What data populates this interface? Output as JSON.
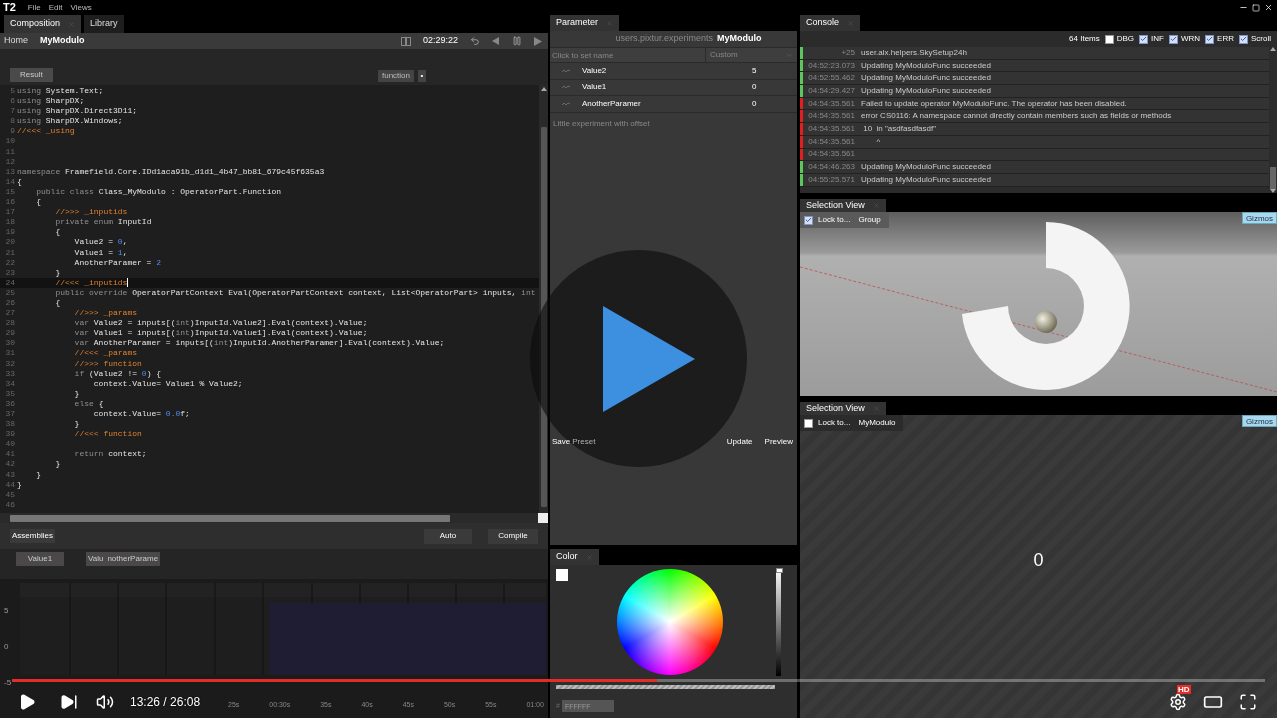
{
  "menu": {
    "logo": "T2",
    "items": [
      "File",
      "Edit",
      "Views"
    ]
  },
  "composition": {
    "tabs": [
      {
        "label": "Composition",
        "selected": true
      },
      {
        "label": "Library",
        "selected": false
      }
    ],
    "breadcrumbs": [
      "Home",
      "MyModulo"
    ],
    "time": "02:29:22",
    "result_button": "Result",
    "function_tag": "function",
    "tag_button": "•",
    "code_lines": [
      {
        "n": "5",
        "highlighted": false,
        "t": [
          {
            "kind": "keyword",
            "text": "using "
          },
          {
            "kind": "code",
            "text": "System.Text;"
          }
        ]
      },
      {
        "n": "6",
        "highlighted": false,
        "t": [
          {
            "kind": "keyword",
            "text": "using "
          },
          {
            "kind": "code",
            "text": "SharpDX;"
          }
        ]
      },
      {
        "n": "7",
        "highlighted": false,
        "t": [
          {
            "kind": "keyword",
            "text": "using "
          },
          {
            "kind": "code",
            "text": "SharpDX.Direct3D11;"
          }
        ]
      },
      {
        "n": "8",
        "highlighted": false,
        "t": [
          {
            "kind": "keyword",
            "text": "using "
          },
          {
            "kind": "code",
            "text": "SharpDX.Windows;"
          }
        ]
      },
      {
        "n": "9",
        "highlighted": false,
        "t": [
          {
            "kind": "comment",
            "text": "//<<< _using"
          }
        ]
      },
      {
        "n": "10",
        "highlighted": false
      },
      {
        "n": "11",
        "highlighted": false
      },
      {
        "n": "12",
        "highlighted": false
      },
      {
        "n": "13",
        "highlighted": false,
        "t": [
          {
            "kind": "keyword",
            "text": "namespace "
          },
          {
            "kind": "code",
            "text": "Framefield.Core.IDd1aca91b_d1d1_4b47_bb81_679c45f635a3"
          }
        ]
      },
      {
        "n": "14",
        "highlighted": false,
        "t": [
          {
            "kind": "code",
            "text": "{"
          }
        ]
      },
      {
        "n": "15",
        "highlighted": false,
        "t": [
          {
            "kind": "keyword",
            "text": "    public class "
          },
          {
            "kind": "code",
            "text": "Class_MyModulo : OperatorPart.Function"
          }
        ]
      },
      {
        "n": "16",
        "highlighted": false,
        "t": [
          {
            "kind": "code",
            "text": "    {"
          }
        ]
      },
      {
        "n": "17",
        "highlighted": false,
        "t": [
          {
            "kind": "comment",
            "text": "        //>>> _inputids"
          }
        ]
      },
      {
        "n": "18",
        "highlighted": false,
        "t": [
          {
            "kind": "keyword",
            "text": "        private enum "
          },
          {
            "kind": "code",
            "text": "InputId"
          }
        ]
      },
      {
        "n": "19",
        "highlighted": false,
        "t": [
          {
            "kind": "code",
            "text": "        {"
          }
        ]
      },
      {
        "n": "20",
        "highlighted": false,
        "t": [
          {
            "kind": "code",
            "text": "            Value2 = "
          },
          {
            "kind": "number",
            "text": "0"
          },
          {
            "kind": "code",
            "text": ","
          }
        ]
      },
      {
        "n": "21",
        "highlighted": false,
        "t": [
          {
            "kind": "code",
            "text": "            Value1 = "
          },
          {
            "kind": "number",
            "text": "1"
          },
          {
            "kind": "code",
            "text": ","
          }
        ]
      },
      {
        "n": "22",
        "highlighted": false,
        "t": [
          {
            "kind": "code",
            "text": "            AnotherParamer = "
          },
          {
            "kind": "number",
            "text": "2"
          }
        ]
      },
      {
        "n": "23",
        "highlighted": false,
        "t": [
          {
            "kind": "code",
            "text": "        }"
          }
        ]
      },
      {
        "n": "24",
        "highlighted": true,
        "t": [
          {
            "kind": "comment",
            "text": "        //<<< _inputids"
          }
        ]
      },
      {
        "n": "25",
        "highlighted": false,
        "t": [
          {
            "kind": "keyword",
            "text": "        public override "
          },
          {
            "kind": "code",
            "text": "OperatorPartContext Eval(OperatorPartContext context, List<OperatorPart> inputs, "
          },
          {
            "kind": "keyword",
            "text": "int"
          }
        ]
      },
      {
        "n": "26",
        "highlighted": false,
        "t": [
          {
            "kind": "code",
            "text": "        {"
          }
        ]
      },
      {
        "n": "27",
        "highlighted": false,
        "t": [
          {
            "kind": "comment",
            "text": "            //>>> _params"
          }
        ]
      },
      {
        "n": "28",
        "highlighted": false,
        "t": [
          {
            "kind": "keyword",
            "text": "            var "
          },
          {
            "kind": "code",
            "text": "Value2 = inputs[("
          },
          {
            "kind": "keyword",
            "text": "int"
          },
          {
            "kind": "code",
            "text": ")InputId.Value2].Eval(context).Value;"
          }
        ]
      },
      {
        "n": "29",
        "highlighted": false,
        "t": [
          {
            "kind": "keyword",
            "text": "            var "
          },
          {
            "kind": "code",
            "text": "Value1 = inputs[("
          },
          {
            "kind": "keyword",
            "text": "int"
          },
          {
            "kind": "code",
            "text": ")InputId.Value1].Eval(context).Value;"
          }
        ]
      },
      {
        "n": "30",
        "highlighted": false,
        "t": [
          {
            "kind": "keyword",
            "text": "            var "
          },
          {
            "kind": "code",
            "text": "AnotherParamer = inputs[("
          },
          {
            "kind": "keyword",
            "text": "int"
          },
          {
            "kind": "code",
            "text": ")InputId.AnotherParamer].Eval(context).Value;"
          }
        ]
      },
      {
        "n": "31",
        "highlighted": false,
        "t": [
          {
            "kind": "comment",
            "text": "            //<<< _params"
          }
        ]
      },
      {
        "n": "32",
        "highlighted": false,
        "t": [
          {
            "kind": "comment",
            "text": "            //>>> function"
          }
        ]
      },
      {
        "n": "33",
        "highlighted": false,
        "t": [
          {
            "kind": "keyword",
            "text": "            if "
          },
          {
            "kind": "code",
            "text": "(Value2 != "
          },
          {
            "kind": "number",
            "text": "0"
          },
          {
            "kind": "code",
            "text": ") {"
          }
        ]
      },
      {
        "n": "34",
        "highlighted": false,
        "t": [
          {
            "kind": "code",
            "text": "                context.Value= Value1 % Value2;"
          }
        ]
      },
      {
        "n": "35",
        "highlighted": false,
        "t": [
          {
            "kind": "code",
            "text": "            }"
          }
        ]
      },
      {
        "n": "36",
        "highlighted": false,
        "t": [
          {
            "kind": "keyword",
            "text": "            else "
          },
          {
            "kind": "code",
            "text": "{"
          }
        ]
      },
      {
        "n": "37",
        "highlighted": false,
        "t": [
          {
            "kind": "code",
            "text": "                context.Value= "
          },
          {
            "kind": "number",
            "text": "0.0"
          },
          {
            "kind": "code",
            "text": "f;"
          }
        ]
      },
      {
        "n": "38",
        "highlighted": false,
        "t": [
          {
            "kind": "code",
            "text": "            }"
          }
        ]
      },
      {
        "n": "39",
        "highlighted": false,
        "t": [
          {
            "kind": "comment",
            "text": "            //<<< function"
          }
        ]
      },
      {
        "n": "40",
        "highlighted": false
      },
      {
        "n": "41",
        "highlighted": false,
        "t": [
          {
            "kind": "keyword",
            "text": "            return "
          },
          {
            "kind": "code",
            "text": "context;"
          }
        ]
      },
      {
        "n": "42",
        "highlighted": false,
        "t": [
          {
            "kind": "code",
            "text": "        }"
          }
        ]
      },
      {
        "n": "43",
        "highlighted": false,
        "t": [
          {
            "kind": "code",
            "text": "    }"
          }
        ]
      },
      {
        "n": "44",
        "highlighted": false,
        "t": [
          {
            "kind": "code",
            "text": "}"
          }
        ]
      },
      {
        "n": "45",
        "highlighted": false
      },
      {
        "n": "46",
        "highlighted": false
      }
    ],
    "toolbar": {
      "assemblies": "Assemblies",
      "auto": "Auto",
      "compile": "Compile"
    },
    "inputs": [
      "Value1",
      "Valu",
      "notherParame"
    ],
    "timeline": {
      "y_labels": [
        "5",
        "0",
        "-5"
      ],
      "x_labels": [
        "25s",
        "00:30s",
        "35s",
        "40s",
        "45s",
        "50s",
        "55s",
        "01:00"
      ]
    }
  },
  "parameter": {
    "tab": "Parameter",
    "path": "users.pixtur.experiments",
    "operator": "MyModulo",
    "name_placeholder": "Click to set name",
    "preset": "Custom",
    "params": [
      {
        "name": "Value2",
        "value": "5"
      },
      {
        "name": "Value1",
        "value": "0"
      },
      {
        "name": "AnotherParamer",
        "value": "0"
      }
    ],
    "description": "Little experiment with offset",
    "save": "Save",
    "preset_label": "Preset",
    "update": "Update",
    "preview": "Preview"
  },
  "color": {
    "tab": "Color",
    "brightness": {
      "level": 1
    },
    "alpha": {
      "level": 1
    },
    "hex_prefix": "#",
    "hex": "FFFFFF"
  },
  "console": {
    "tab": "Console",
    "count": "64 Items",
    "filters": [
      {
        "label": "DBG",
        "checked": false
      },
      {
        "label": "INF",
        "checked": true
      },
      {
        "label": "WRN",
        "checked": true
      },
      {
        "label": "ERR",
        "checked": true
      },
      {
        "label": "Scroll",
        "checked": true
      }
    ],
    "rows": [
      {
        "time": "+25",
        "message": "user.alx.helpers.SkySetup24h",
        "color": "#5cc85c"
      },
      {
        "time": "04:52:23.073",
        "message": "Updating MyModuloFunc succeeded",
        "color": "#5cc85c"
      },
      {
        "time": "04:52:55.462",
        "message": "Updating MyModuloFunc succeeded",
        "color": "#5cc85c"
      },
      {
        "time": "04:54:29.427",
        "message": "Updating MyModuloFunc succeeded",
        "color": "#5cc85c"
      },
      {
        "time": "04:54:35.561",
        "message": "Failed to update operator MyModuloFunc. The operator has been disabled.",
        "color": "#e02020"
      },
      {
        "time": "04:54:35.561",
        "message": "error CS0116: A namespace cannot directly contain members such as fields or methods",
        "color": "#e02020"
      },
      {
        "time": "04:54:35.561",
        "message": " 10  in \"asdfasdfasdf\"",
        "color": "#e02020"
      },
      {
        "time": "04:54:35.561",
        "message": "       ^",
        "color": "#e02020"
      },
      {
        "time": "04:54:35.561",
        "color": "#e02020"
      },
      {
        "time": "04:54:46.263",
        "message": "Updating MyModuloFunc succeeded",
        "color": "#5cc85c"
      },
      {
        "time": "04:55:25.571",
        "message": "Updating MyModuloFunc succeeded",
        "color": "#5cc85c"
      }
    ]
  },
  "selection_views": [
    {
      "kind": "scene",
      "tab": "Selection View",
      "lock_label": "Lock to...",
      "locked": true,
      "target": "Group",
      "gizmos": "Gizmos"
    },
    {
      "kind": "value",
      "tab": "Selection View",
      "lock_label": "Lock to...",
      "locked": false,
      "target": "MyModulo",
      "gizmos": "Gizmos",
      "value": "0"
    }
  ],
  "player": {
    "progress": {
      "level": 0.515
    },
    "time": "13:26 / 26:08",
    "badge": "HD"
  }
}
